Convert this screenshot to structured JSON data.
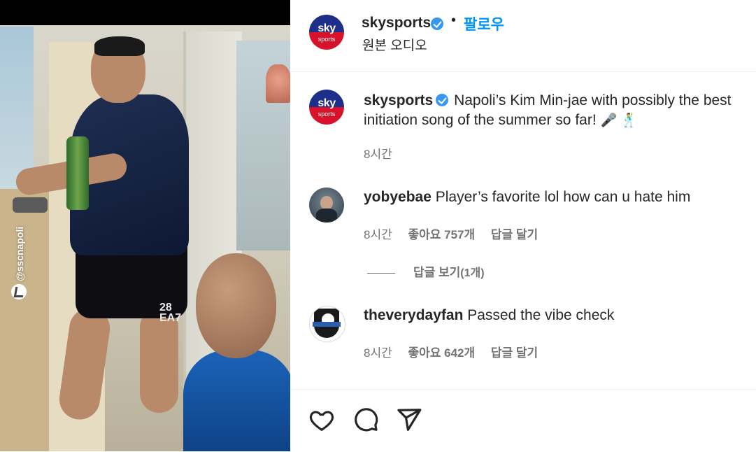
{
  "media": {
    "watermark": "@sscnapoli",
    "jersey_number": "28",
    "jersey_brand": "EA7"
  },
  "header": {
    "username": "skysports",
    "follow_label": "팔로우",
    "separator": "•",
    "audio_label": "원본 오디오",
    "avatar_top": "sky",
    "avatar_bottom": "sports"
  },
  "caption": {
    "username": "skysports",
    "text": "Napoli’s Kim Min-jae with possibly the best initiation song of the summer so far!",
    "emoji": "🎤 🕺",
    "time": "8시간"
  },
  "comments": [
    {
      "username": "yobyebae",
      "text": "Player’s favorite lol how can u hate him",
      "time": "8시간",
      "likes": "좋아요 757개",
      "reply": "답글 달기",
      "view_replies": "답글 보기",
      "reply_count": "(1개)"
    },
    {
      "username": "theverydayfan",
      "text": "Passed the vibe check",
      "time": "8시간",
      "likes": "좋아요 642개",
      "reply": "답글 달기"
    }
  ],
  "actions": {
    "icons": [
      "heart-icon",
      "comment-icon",
      "share-icon"
    ]
  },
  "colors": {
    "accent": "#0095f6",
    "verified": "#3897f0",
    "secondary_text": "#737373",
    "sky_blue": "#1e2f8a",
    "sky_red": "#d8122a"
  }
}
